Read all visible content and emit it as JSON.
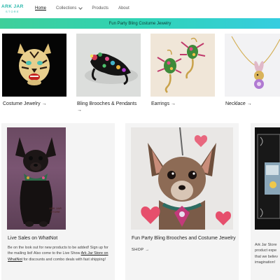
{
  "brand": {
    "name": "ARK JAR",
    "tagline": "STORE"
  },
  "nav": {
    "items": [
      {
        "label": "Home",
        "active": true,
        "dropdown": false
      },
      {
        "label": "Collections",
        "active": false,
        "dropdown": true
      },
      {
        "label": "Products",
        "active": false,
        "dropdown": false
      },
      {
        "label": "About",
        "active": false,
        "dropdown": false
      }
    ]
  },
  "announcement": {
    "text": "Fun Party Bling Costume Jewelry",
    "gradient": [
      "#3fcf9a",
      "#36cde0"
    ]
  },
  "collections": [
    {
      "label": "Costume Jewelry",
      "icon": "tiger-brooch-image"
    },
    {
      "label": "Bling Brooches & Pendants",
      "icon": "frog-brooch-image"
    },
    {
      "label": "Earrings",
      "icon": "scorpion-earrings-image"
    },
    {
      "label": "Necklace",
      "icon": "bunny-necklace-image"
    }
  ],
  "features": {
    "live": {
      "title": "Live Sales on WhatNot",
      "text_before": "Be on the look out for new products to be added! Sign up for the mailing list! Also come to the Live Show ",
      "link": "Ark Jar Store on WhatNot",
      "text_after": " for discounts and combo deals with fast shipping!",
      "watermark_line1": "ARK JAR",
      "watermark_line2": "STORE"
    },
    "party": {
      "title": "Fun Party Bling Brooches and Costume Jewelry",
      "shop_label": "SHOP"
    },
    "partial": {
      "text": "Ark Jar Store product expe that we believ imagination!"
    }
  },
  "colors": {
    "accent": "#25b6a9",
    "card_bg": "#f4f4f4"
  }
}
